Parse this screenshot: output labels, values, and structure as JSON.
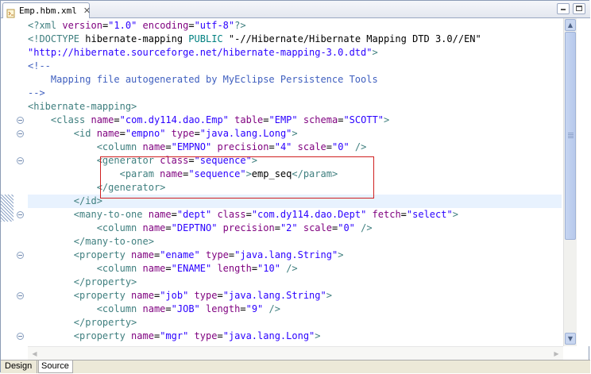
{
  "tab": {
    "title": "Emp.hbm.xml",
    "close": "✕"
  },
  "editor": {
    "lines": [
      [
        [
          "pi",
          "<?xml "
        ],
        [
          "attr",
          "version"
        ],
        [
          "txt",
          "="
        ],
        [
          "val",
          "\"1.0\""
        ],
        [
          "txt",
          " "
        ],
        [
          "attr",
          "encoding"
        ],
        [
          "txt",
          "="
        ],
        [
          "val",
          "\"utf-8\""
        ],
        [
          "pi",
          "?>"
        ]
      ],
      [
        [
          "tag",
          "<!DOCTYPE "
        ],
        [
          "txt",
          "hibernate-mapping "
        ],
        [
          "dt",
          "PUBLIC "
        ],
        [
          "txt",
          "\"-//Hibernate/Hibernate Mapping DTD 3.0//EN\""
        ]
      ],
      [
        [
          "val",
          "\"http://hibernate.sourceforge.net/hibernate-mapping-3.0.dtd\""
        ],
        [
          "tag",
          ">"
        ]
      ],
      [
        [
          "com",
          "<!--"
        ]
      ],
      [
        [
          "com",
          "    Mapping file autogenerated by MyEclipse Persistence Tools"
        ]
      ],
      [
        [
          "com",
          "-->"
        ]
      ],
      [
        [
          "tag",
          "<hibernate-mapping>"
        ]
      ],
      [
        [
          "txt",
          "    "
        ],
        [
          "tag",
          "<class "
        ],
        [
          "attr",
          "name"
        ],
        [
          "txt",
          "="
        ],
        [
          "val",
          "\"com.dy114.dao.Emp\""
        ],
        [
          "txt",
          " "
        ],
        [
          "attr",
          "table"
        ],
        [
          "txt",
          "="
        ],
        [
          "val",
          "\"EMP\""
        ],
        [
          "txt",
          " "
        ],
        [
          "attr",
          "schema"
        ],
        [
          "txt",
          "="
        ],
        [
          "val",
          "\"SCOTT\""
        ],
        [
          "tag",
          ">"
        ]
      ],
      [
        [
          "txt",
          "        "
        ],
        [
          "tag",
          "<id "
        ],
        [
          "attr",
          "name"
        ],
        [
          "txt",
          "="
        ],
        [
          "val",
          "\"empno\""
        ],
        [
          "txt",
          " "
        ],
        [
          "attr",
          "type"
        ],
        [
          "txt",
          "="
        ],
        [
          "val",
          "\"java.lang.Long\""
        ],
        [
          "tag",
          ">"
        ]
      ],
      [
        [
          "txt",
          "            "
        ],
        [
          "tag",
          "<column "
        ],
        [
          "attr",
          "name"
        ],
        [
          "txt",
          "="
        ],
        [
          "val",
          "\"EMPNO\""
        ],
        [
          "txt",
          " "
        ],
        [
          "attr",
          "precision"
        ],
        [
          "txt",
          "="
        ],
        [
          "val",
          "\"4\""
        ],
        [
          "txt",
          " "
        ],
        [
          "attr",
          "scale"
        ],
        [
          "txt",
          "="
        ],
        [
          "val",
          "\"0\""
        ],
        [
          "txt",
          " "
        ],
        [
          "tag",
          "/>"
        ]
      ],
      [
        [
          "txt",
          "            "
        ],
        [
          "tag",
          "<generator "
        ],
        [
          "attr",
          "class"
        ],
        [
          "txt",
          "="
        ],
        [
          "val",
          "\"sequence\""
        ],
        [
          "tag",
          ">"
        ]
      ],
      [
        [
          "txt",
          "                "
        ],
        [
          "tag",
          "<param "
        ],
        [
          "attr",
          "name"
        ],
        [
          "txt",
          "="
        ],
        [
          "val",
          "\"sequence\""
        ],
        [
          "tag",
          ">"
        ],
        [
          "txt",
          "emp_seq"
        ],
        [
          "tag",
          "</param>"
        ]
      ],
      [
        [
          "txt",
          "            "
        ],
        [
          "tag",
          "</generator>"
        ]
      ],
      [
        [
          "txt",
          "        "
        ],
        [
          "tag",
          "</id>"
        ]
      ],
      [
        [
          "txt",
          "        "
        ],
        [
          "tag",
          "<many-to-one "
        ],
        [
          "attr",
          "name"
        ],
        [
          "txt",
          "="
        ],
        [
          "val",
          "\"dept\""
        ],
        [
          "txt",
          " "
        ],
        [
          "attr",
          "class"
        ],
        [
          "txt",
          "="
        ],
        [
          "val",
          "\"com.dy114.dao.Dept\""
        ],
        [
          "txt",
          " "
        ],
        [
          "attr",
          "fetch"
        ],
        [
          "txt",
          "="
        ],
        [
          "val",
          "\"select\""
        ],
        [
          "tag",
          ">"
        ]
      ],
      [
        [
          "txt",
          "            "
        ],
        [
          "tag",
          "<column "
        ],
        [
          "attr",
          "name"
        ],
        [
          "txt",
          "="
        ],
        [
          "val",
          "\"DEPTNO\""
        ],
        [
          "txt",
          " "
        ],
        [
          "attr",
          "precision"
        ],
        [
          "txt",
          "="
        ],
        [
          "val",
          "\"2\""
        ],
        [
          "txt",
          " "
        ],
        [
          "attr",
          "scale"
        ],
        [
          "txt",
          "="
        ],
        [
          "val",
          "\"0\""
        ],
        [
          "txt",
          " "
        ],
        [
          "tag",
          "/>"
        ]
      ],
      [
        [
          "txt",
          "        "
        ],
        [
          "tag",
          "</many-to-one>"
        ]
      ],
      [
        [
          "txt",
          "        "
        ],
        [
          "tag",
          "<property "
        ],
        [
          "attr",
          "name"
        ],
        [
          "txt",
          "="
        ],
        [
          "val",
          "\"ename\""
        ],
        [
          "txt",
          " "
        ],
        [
          "attr",
          "type"
        ],
        [
          "txt",
          "="
        ],
        [
          "val",
          "\"java.lang.String\""
        ],
        [
          "tag",
          ">"
        ]
      ],
      [
        [
          "txt",
          "            "
        ],
        [
          "tag",
          "<column "
        ],
        [
          "attr",
          "name"
        ],
        [
          "txt",
          "="
        ],
        [
          "val",
          "\"ENAME\""
        ],
        [
          "txt",
          " "
        ],
        [
          "attr",
          "length"
        ],
        [
          "txt",
          "="
        ],
        [
          "val",
          "\"10\""
        ],
        [
          "txt",
          " "
        ],
        [
          "tag",
          "/>"
        ]
      ],
      [
        [
          "txt",
          "        "
        ],
        [
          "tag",
          "</property>"
        ]
      ],
      [
        [
          "txt",
          "        "
        ],
        [
          "tag",
          "<property "
        ],
        [
          "attr",
          "name"
        ],
        [
          "txt",
          "="
        ],
        [
          "val",
          "\"job\""
        ],
        [
          "txt",
          " "
        ],
        [
          "attr",
          "type"
        ],
        [
          "txt",
          "="
        ],
        [
          "val",
          "\"java.lang.String\""
        ],
        [
          "tag",
          ">"
        ]
      ],
      [
        [
          "txt",
          "            "
        ],
        [
          "tag",
          "<column "
        ],
        [
          "attr",
          "name"
        ],
        [
          "txt",
          "="
        ],
        [
          "val",
          "\"JOB\""
        ],
        [
          "txt",
          " "
        ],
        [
          "attr",
          "length"
        ],
        [
          "txt",
          "="
        ],
        [
          "val",
          "\"9\""
        ],
        [
          "txt",
          " "
        ],
        [
          "tag",
          "/>"
        ]
      ],
      [
        [
          "txt",
          "        "
        ],
        [
          "tag",
          "</property>"
        ]
      ],
      [
        [
          "txt",
          "        "
        ],
        [
          "tag",
          "<property "
        ],
        [
          "attr",
          "name"
        ],
        [
          "txt",
          "="
        ],
        [
          "val",
          "\"mgr\""
        ],
        [
          "txt",
          " "
        ],
        [
          "attr",
          "type"
        ],
        [
          "txt",
          "="
        ],
        [
          "val",
          "\"java.lang.Long\""
        ],
        [
          "tag",
          ">"
        ]
      ]
    ],
    "fold_lines": [
      7,
      8,
      10,
      14,
      17,
      20,
      23
    ],
    "highlight_line": 13,
    "marked_lines": [
      10,
      11,
      12
    ]
  },
  "bottom_tabs": {
    "design": "Design",
    "source": "Source"
  },
  "colors": {
    "tag": "#3f7f7f",
    "attr": "#7f007f",
    "value": "#2a00ff",
    "comment": "#3f5fbf",
    "highlight": "#e8f2fe",
    "mark_border": "#d02020"
  }
}
